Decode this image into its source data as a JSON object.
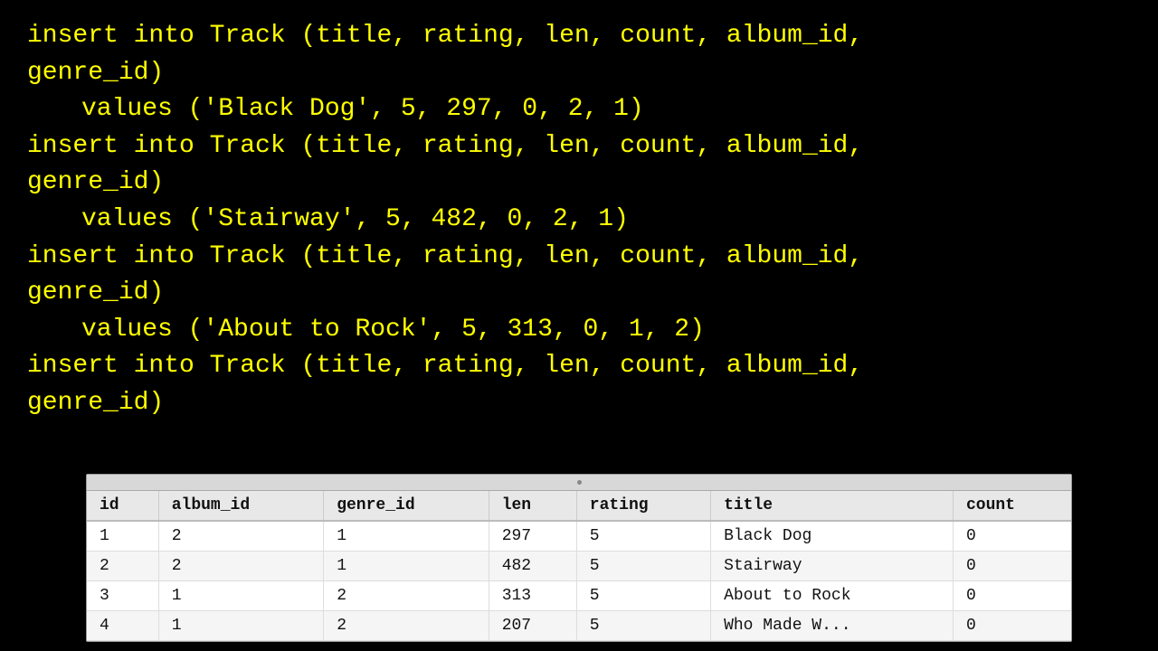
{
  "background": "#000000",
  "code": {
    "color": "#ffff00",
    "lines": [
      "insert into Track (title, rating, len, count, album_id,",
      "genre_id)",
      "     values ('Black Dog', 5, 297, 0, 2, 1)",
      "insert into Track (title, rating, len, count, album_id,",
      "genre_id)",
      "     values ('Stairway', 5, 482, 0, 2, 1)",
      "insert into Track (title, rating, len, count, album_id,",
      "genre_id)",
      "     values ('About to Rock', 5, 313, 0, 1, 2)",
      "insert into Track (title, rating, len, count, album_id,",
      "genre_id)"
    ]
  },
  "table": {
    "columns": [
      "id",
      "album_id",
      "genre_id",
      "len",
      "rating",
      "title",
      "count"
    ],
    "rows": [
      {
        "id": "1",
        "album_id": "2",
        "genre_id": "1",
        "len": "297",
        "rating": "5",
        "title": "Black Dog",
        "count": "0"
      },
      {
        "id": "2",
        "album_id": "2",
        "genre_id": "1",
        "len": "482",
        "rating": "5",
        "title": "Stairway",
        "count": "0"
      },
      {
        "id": "3",
        "album_id": "1",
        "genre_id": "2",
        "len": "313",
        "rating": "5",
        "title": "About to Rock",
        "count": "0"
      },
      {
        "id": "4",
        "album_id": "1",
        "genre_id": "2",
        "len": "207",
        "rating": "5",
        "title": "Who Made W...",
        "count": "0"
      }
    ]
  }
}
